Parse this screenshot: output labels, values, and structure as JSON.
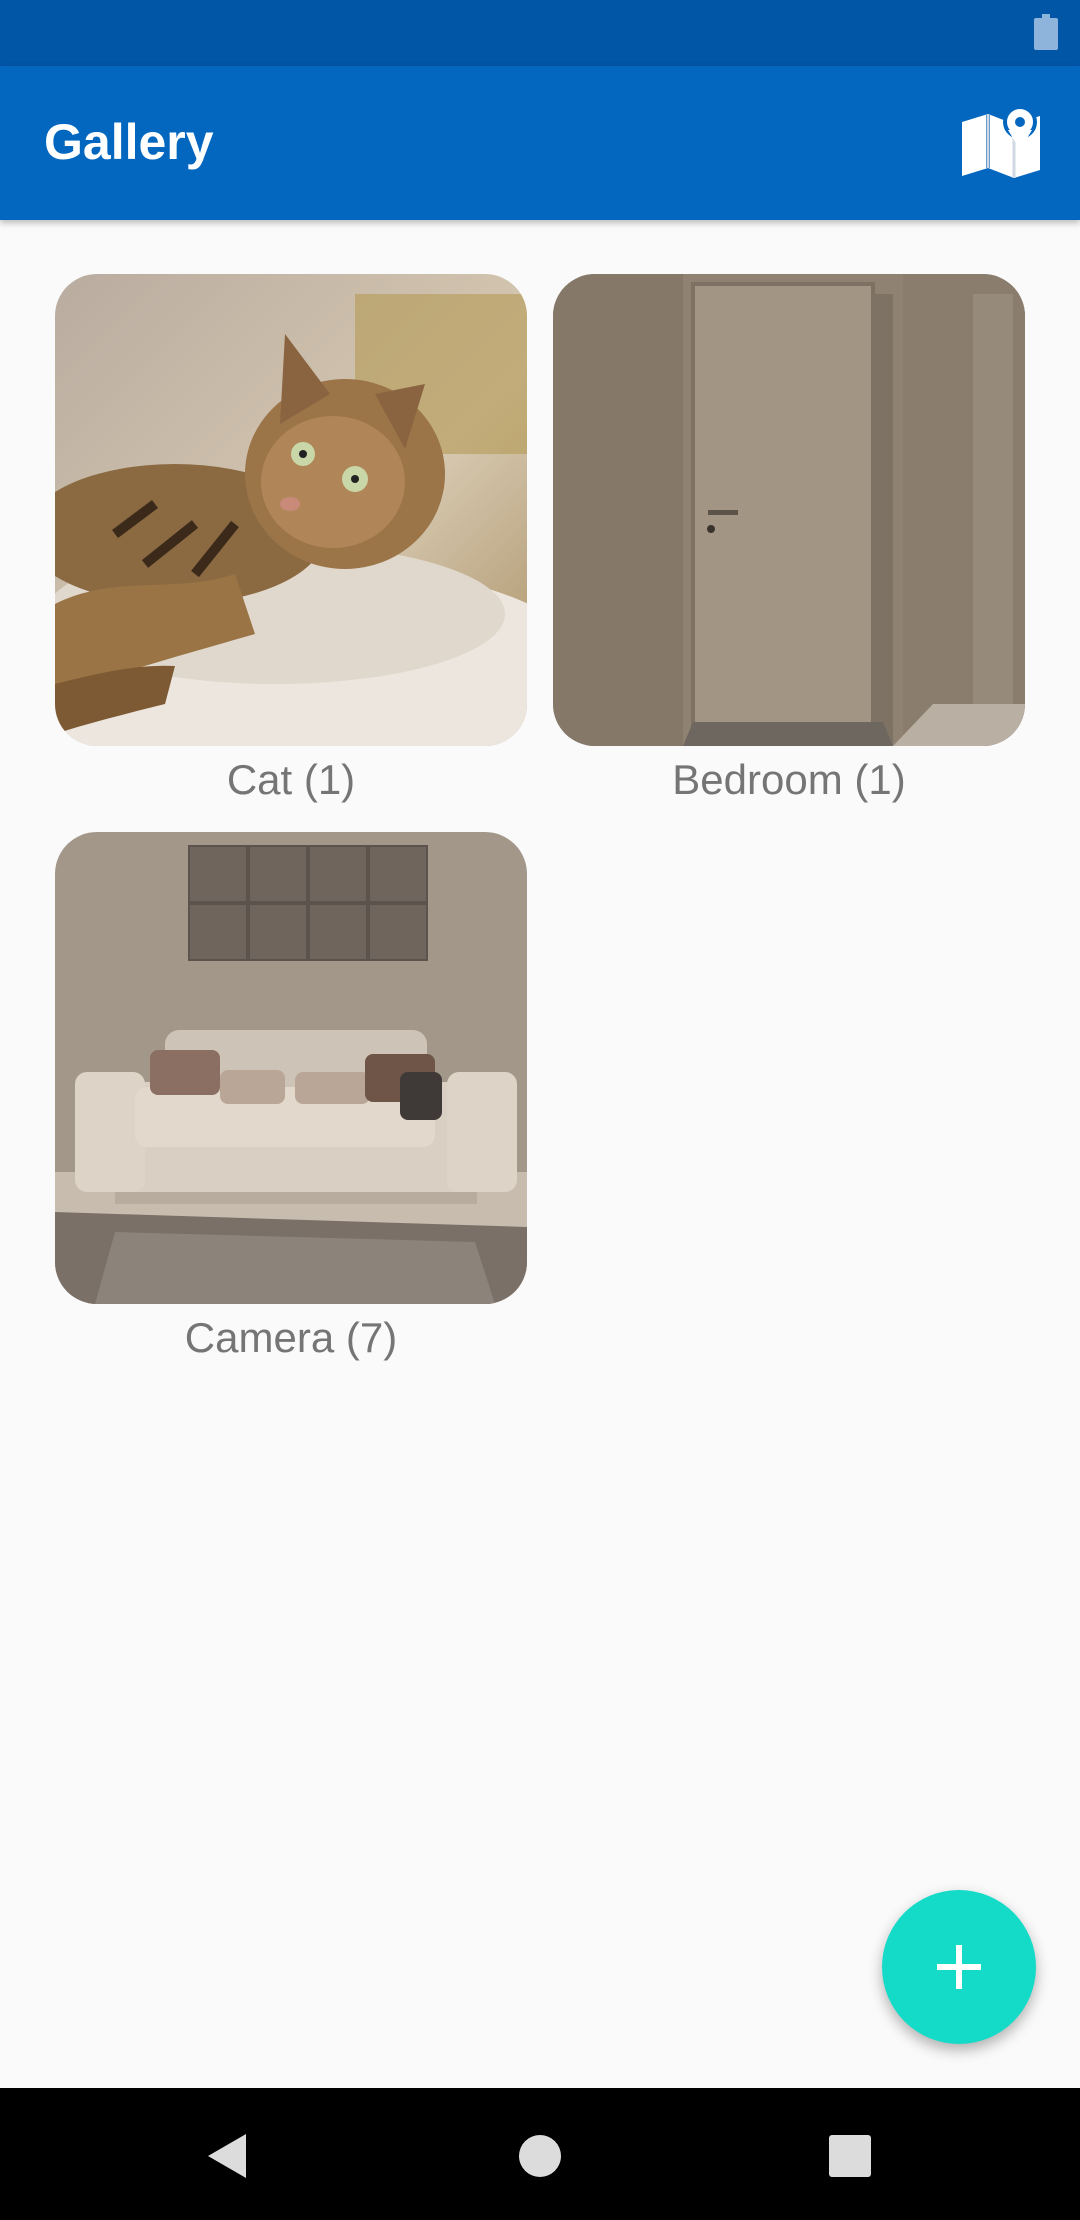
{
  "app_bar": {
    "title": "Gallery",
    "map_icon": "map-pin-icon",
    "color": "#0467bf"
  },
  "status_bar": {
    "battery_icon": "battery-icon",
    "color": "#0256a6"
  },
  "albums": [
    {
      "label": "Cat (1)",
      "thumbnail": "cat-photo"
    },
    {
      "label": "Bedroom (1)",
      "thumbnail": "door-photo"
    },
    {
      "label": "Camera (7)",
      "thumbnail": "sofa-photo"
    }
  ],
  "fab": {
    "icon": "plus-icon",
    "color": "#14dbc7"
  },
  "nav_bar": {
    "back_icon": "back-icon",
    "home_icon": "home-icon",
    "recents_icon": "recents-icon"
  }
}
